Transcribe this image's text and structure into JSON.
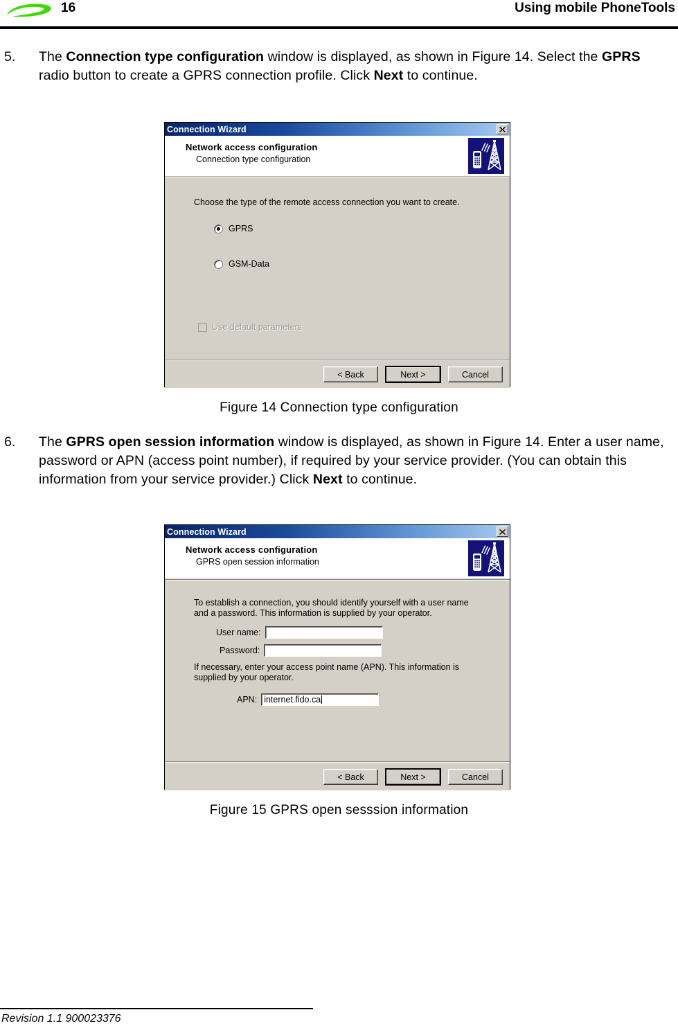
{
  "page": {
    "number": "16",
    "header_title": "Using mobile PhoneTools",
    "logo": "green-swoosh-logo",
    "footer_text": "Revision 1.1 900023376"
  },
  "steps": [
    {
      "number": "5.",
      "segments": [
        {
          "text": "The ",
          "bold": false
        },
        {
          "text": "Connection type configuration",
          "bold": true
        },
        {
          "text": " window is displayed, as shown in Figure 14. Select the ",
          "bold": false
        },
        {
          "text": "GPRS",
          "bold": true
        },
        {
          "text": " radio button to create a GPRS connection profile. Click ",
          "bold": false
        },
        {
          "text": "Next",
          "bold": true
        },
        {
          "text": " to continue.",
          "bold": false
        }
      ]
    },
    {
      "number": "6.",
      "segments": [
        {
          "text": "The ",
          "bold": false
        },
        {
          "text": "GPRS open session information",
          "bold": true
        },
        {
          "text": " window is displayed, as shown in Figure 14. Enter a user name, password or APN (access point number), if required by your service provider. (You can obtain this information from your service provider.) Click ",
          "bold": false
        },
        {
          "text": "Next",
          "bold": true
        },
        {
          "text": " to continue.",
          "bold": false
        }
      ]
    }
  ],
  "dialog1": {
    "titlebar": {
      "title": "Connection Wizard",
      "close_label": "x"
    },
    "header": {
      "title": "Network access configuration",
      "subtitle": "Connection type configuration",
      "icon": "phone-tower-icon"
    },
    "body": {
      "intro": "Choose the type of the remote access connection you want to create.",
      "radios": [
        {
          "label": "GPRS",
          "checked": true
        },
        {
          "label": "GSM-Data",
          "checked": false
        }
      ],
      "checkbox": {
        "label": "Use default parameters",
        "checked": false,
        "disabled": true
      }
    },
    "buttons": [
      {
        "label": "< Back",
        "default": false
      },
      {
        "label": "Next >",
        "default": true
      },
      {
        "label": "Cancel",
        "default": false
      }
    ]
  },
  "dialog2": {
    "titlebar": {
      "title": "Connection Wizard",
      "close_label": "x"
    },
    "header": {
      "title": "Network access configuration",
      "subtitle": "GPRS open session information",
      "icon": "phone-tower-icon"
    },
    "body": {
      "para_credentials": "To establish a connection, you should identify yourself with a user name and a password. This information is supplied by your operator.",
      "para_apn": "If necessary, enter your access point name (APN). This information is supplied by your operator.",
      "fields": [
        {
          "label": "User name:",
          "value": "",
          "caret": false
        },
        {
          "label": "Password:",
          "value": "",
          "caret": false
        },
        {
          "label": "APN:",
          "value": "internet.fido.ca",
          "caret": true
        }
      ]
    },
    "buttons": [
      {
        "label": "< Back",
        "default": false
      },
      {
        "label": "Next >",
        "default": true
      },
      {
        "label": "Cancel",
        "default": false
      }
    ]
  },
  "captions": {
    "figure14": "Figure 14 Connection type configuration",
    "figure15": "Figure 15 GPRS open sesssion information"
  },
  "colors": {
    "logo_green": "#3ddb00",
    "titlebar_dark": "#07246b",
    "titlebar_light": "#a8cbf0",
    "dialog_face": "#d4d0c8",
    "icon_navy": "#12127a"
  }
}
